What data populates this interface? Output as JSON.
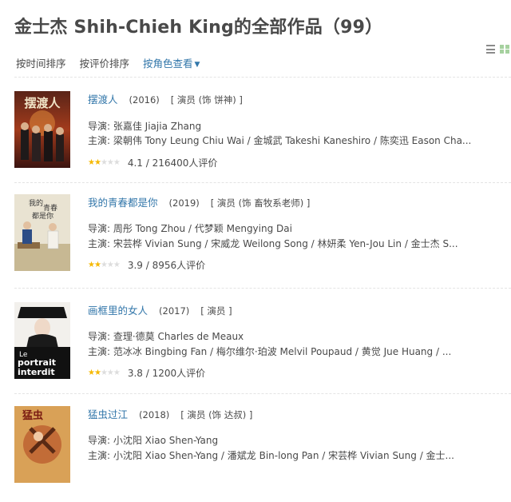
{
  "page_title": "金士杰 Shih-Chieh King的全部作品（99）",
  "sort": {
    "by_time": "按时间排序",
    "by_rating": "按评价排序",
    "by_role": "按角色查看"
  },
  "colors": {
    "link": "#3377aa",
    "star": "#f5b800",
    "grid_icon": "#a6d19f"
  },
  "works": [
    {
      "title": "摆渡人",
      "year": "(2016)",
      "role": "[ 演员 (饰 饼神) ]",
      "director": "导演: 张嘉佳 Jiajia Zhang",
      "cast": "主演: 梁朝伟 Tony Leung Chiu Wai / 金城武 Takeshi Kaneshiro / 陈奕迅 Eason Cha...",
      "stars": 2,
      "rating_text": "4.1 / 216400人评价",
      "poster_title": "摆渡人"
    },
    {
      "title": "我的青春都是你",
      "year": "(2019)",
      "role": "[ 演员 (饰 畜牧系老师) ]",
      "director": "导演: 周彤 Tong Zhou / 代梦颖 Mengying Dai",
      "cast": "主演: 宋芸桦 Vivian Sung / 宋威龙 Weilong Song / 林妍柔 Yen-Jou Lin / 金士杰 S...",
      "stars": 2,
      "rating_text": "3.9 / 8956人评价",
      "poster_title": "我的青春都是你"
    },
    {
      "title": "画框里的女人",
      "year": "(2017)",
      "role": "[ 演员 ]",
      "director": "导演: 查理·德莫 Charles de Meaux",
      "cast": "主演: 范冰冰 Bingbing Fan / 梅尔维尔·珀波 Melvil Poupaud / 黄觉 Jue Huang / ...",
      "stars": 2,
      "rating_text": "3.8 / 1200人评价",
      "poster_title": "Le portrait interdit"
    },
    {
      "title": "猛虫过江",
      "year": "(2018)",
      "role": "[ 演员 (饰 达叔) ]",
      "director": "导演: 小沈阳 Xiao Shen-Yang",
      "cast": "主演: 小沈阳 Xiao Shen-Yang / 潘斌龙 Bin-long Pan / 宋芸桦 Vivian Sung / 金士...",
      "stars": 0,
      "rating_text": "",
      "poster_title": "猛虫过江"
    }
  ]
}
